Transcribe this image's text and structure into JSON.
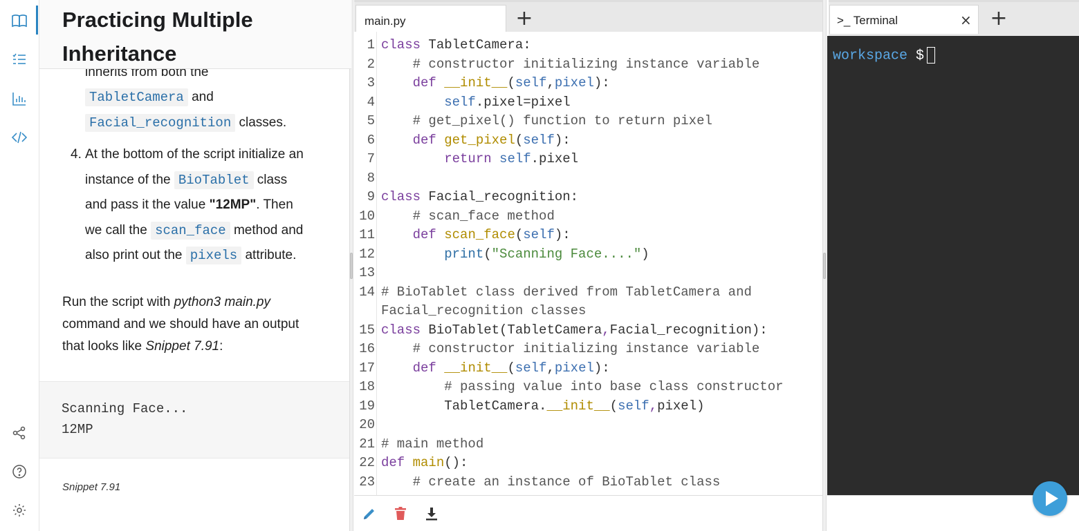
{
  "lesson": {
    "title_line1": "Practicing Multiple",
    "title_line2": "Inheritance",
    "frag_line": "inherits from both the",
    "chip_tablet": "TabletCamera",
    "and_text": "and",
    "chip_facial": "Facial_recognition",
    "classes_text": "classes.",
    "step_number": "4.",
    "step_l1": "At the bottom of the script initialize an",
    "step_l2_pre": "instance of the",
    "chip_bio": "BioTablet",
    "step_l2_post": "class",
    "step_l3_pre": "and pass it the value",
    "step_l3_value": "\"12MP\"",
    "step_l3_post": ". Then",
    "step_l4_pre": "we call the",
    "chip_scan": "scan_face",
    "step_l4_post": "method and",
    "step_l5_pre": "also print out the",
    "chip_pixels": "pixels",
    "step_l5_post": "attribute.",
    "run_l1_pre": "Run the script with",
    "run_l1_cmd": "python3 main.py",
    "run_l2": "command and we should have an output",
    "run_l3_pre": "that looks like",
    "run_l3_ref": "Snippet 7.91",
    "run_l3_post": ":",
    "output": [
      "Scanning Face...",
      "12MP"
    ],
    "caption": "Snippet 7.91"
  },
  "rail_icons": [
    "book-icon",
    "checklist-icon",
    "chart-icon",
    "code-icon",
    "share-icon",
    "help-icon",
    "settings-icon"
  ],
  "editor": {
    "tab_label": "main.py",
    "add_tab": "+",
    "line_numbers": [
      "1",
      "2",
      "3",
      "4",
      "5",
      "6",
      "7",
      "8",
      "9",
      "10",
      "11",
      "12",
      "13",
      "14",
      "",
      "15",
      "16",
      "17",
      "18",
      "19",
      "20",
      "21",
      "22",
      "23"
    ]
  },
  "terminal": {
    "tab_label": ">_  Terminal",
    "close": "×",
    "add_tab": "+",
    "prompt_ws": "workspace",
    "prompt_sign": "$"
  },
  "colors": {
    "accent": "#2a84c1",
    "run_button": "#3d9ed9",
    "terminal_bg": "#2c2c2c",
    "keyword": "#7a3e9d",
    "string": "#4b8a3c"
  }
}
